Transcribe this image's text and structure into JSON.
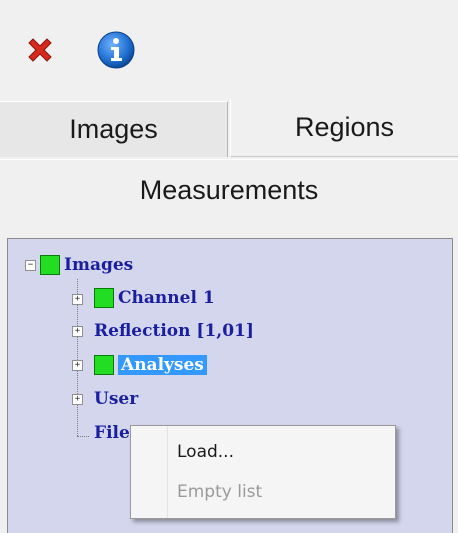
{
  "toolbar": {
    "close_icon": "red-x-icon",
    "info_icon": "info-icon",
    "accent_close": "#d62a1e",
    "accent_info": "#1f6fd1"
  },
  "tabs": {
    "images": "Images",
    "regions": "Regions",
    "measurements": "Measurements"
  },
  "tree": {
    "root": {
      "label": "Images",
      "expander": "−"
    },
    "children": [
      {
        "label": "Channel 1",
        "expander": "+"
      },
      {
        "label": "Reflection [1,01]",
        "expander": "+"
      },
      {
        "label": "Analyses",
        "expander": "+",
        "selected": true
      },
      {
        "label": "User",
        "expander": "+"
      },
      {
        "label": "File"
      }
    ],
    "swatch_color": "#22dd22",
    "text_color": "#1a1f9e",
    "panel_bg": "#d4d6ee"
  },
  "context_menu": {
    "items": [
      {
        "label": "Load...",
        "enabled": true
      },
      {
        "label": "Empty list",
        "enabled": false
      }
    ]
  }
}
